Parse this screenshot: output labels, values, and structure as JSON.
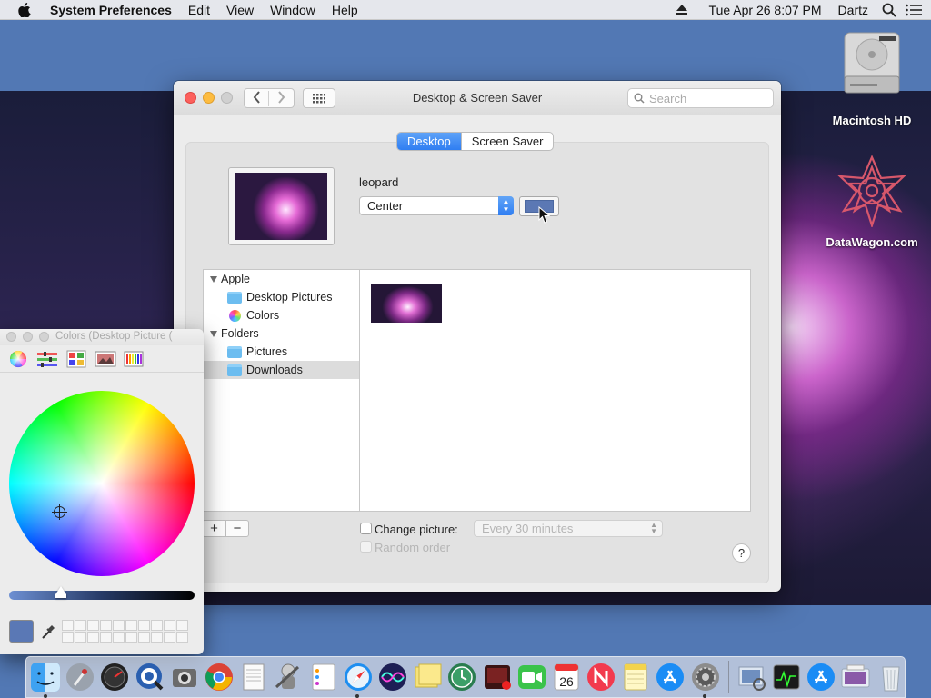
{
  "menubar": {
    "app_name": "System Preferences",
    "menus": [
      "Edit",
      "View",
      "Window",
      "Help"
    ],
    "clock": "Tue Apr 26  8:07 PM",
    "user": "Dartz"
  },
  "desktop_icons": [
    {
      "label": "Macintosh HD",
      "icon": "hard-drive-icon"
    },
    {
      "label": "DataWagon.com",
      "icon": "datawagon-logo-icon"
    }
  ],
  "window": {
    "title": "Desktop & Screen Saver",
    "search_placeholder": "Search",
    "tabs": [
      {
        "label": "Desktop",
        "active": true
      },
      {
        "label": "Screen Saver",
        "active": false
      }
    ],
    "wallpaper_name": "leopard",
    "placement": "Center",
    "background_color": "#5b78b4",
    "sidebar": [
      {
        "group": "Apple",
        "items": [
          {
            "label": "Desktop Pictures",
            "icon": "folder-icon"
          },
          {
            "label": "Colors",
            "icon": "color-wheel-icon"
          }
        ]
      },
      {
        "group": "Folders",
        "items": [
          {
            "label": "Pictures",
            "icon": "pictures-folder-icon"
          },
          {
            "label": "Downloads",
            "icon": "folder-icon",
            "selected": true
          }
        ]
      }
    ],
    "add_label": "+",
    "remove_label": "−",
    "change_picture_label": "Change picture:",
    "change_picture_checked": false,
    "interval": "Every 30 minutes",
    "random_order_label": "Random order",
    "help_label": "?"
  },
  "colors_panel": {
    "title": "Colors (Desktop Picture (",
    "modes": [
      "color-wheel-icon",
      "sliders-icon",
      "palettes-icon",
      "image-palettes-icon",
      "pencils-icon"
    ],
    "current_color": "#5a78b5",
    "brightness": 0.28
  },
  "dock": {
    "apps": [
      {
        "name": "finder-icon",
        "running": true
      },
      {
        "name": "launchpad-icon",
        "running": false
      },
      {
        "name": "dashboard-icon",
        "running": false
      },
      {
        "name": "quicktime-icon",
        "running": false
      },
      {
        "name": "screenshot-icon",
        "running": false
      },
      {
        "name": "chrome-icon",
        "running": false
      },
      {
        "name": "textedit-icon",
        "running": false
      },
      {
        "name": "automator-icon",
        "running": false
      },
      {
        "name": "reminders-icon",
        "running": false
      },
      {
        "name": "safari-icon",
        "running": true
      },
      {
        "name": "siri-icon",
        "running": false
      },
      {
        "name": "stickies-icon",
        "running": false
      },
      {
        "name": "time-machine-icon",
        "running": false
      },
      {
        "name": "photo-booth-icon",
        "running": false
      },
      {
        "name": "facetime-icon",
        "running": false
      },
      {
        "name": "calendar-icon",
        "running": false
      },
      {
        "name": "news-icon",
        "running": false
      },
      {
        "name": "notes-icon",
        "running": false
      },
      {
        "name": "app-store-icon",
        "running": false
      },
      {
        "name": "system-preferences-icon",
        "running": true
      }
    ],
    "others": [
      {
        "name": "preview-icon"
      },
      {
        "name": "activity-monitor-icon"
      },
      {
        "name": "app-store-downloads-icon"
      },
      {
        "name": "desktop-folder-icon"
      },
      {
        "name": "trash-icon"
      }
    ],
    "calendar_day": "26"
  }
}
